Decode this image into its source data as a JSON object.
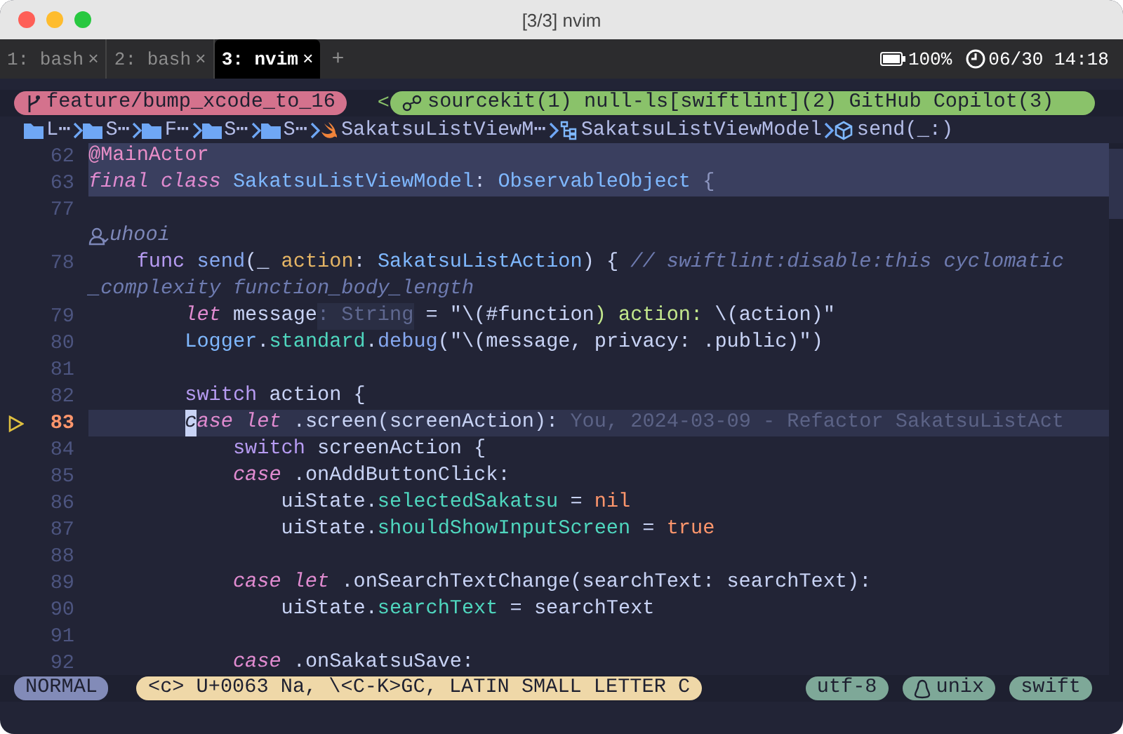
{
  "window": {
    "title": "[3/3] nvim"
  },
  "tabs": [
    {
      "label": "1: bash",
      "close": "×",
      "selected": false
    },
    {
      "label": "2: bash",
      "close": "×",
      "selected": false
    },
    {
      "label": "3: nvim",
      "close": "×",
      "selected": true
    }
  ],
  "new_tab": "+",
  "status_right": {
    "battery": "100%",
    "clock": "06/30 14:18"
  },
  "statusline_top": {
    "branch": "feature/bump_xcode_to_16",
    "lsp_separator": "<",
    "lsp": "sourcekit(1) null-ls[swiftlint](2) GitHub Copilot(3)"
  },
  "breadcrumbs": [
    {
      "kind": "folder",
      "label": "L⋯"
    },
    {
      "kind": "folder",
      "label": "S⋯"
    },
    {
      "kind": "folder",
      "label": "F⋯"
    },
    {
      "kind": "folder",
      "label": "S⋯"
    },
    {
      "kind": "folder",
      "label": "S⋯"
    },
    {
      "kind": "file",
      "label": "SakatsuListViewM⋯"
    },
    {
      "kind": "class",
      "label": "SakatsuListViewModel"
    },
    {
      "kind": "method",
      "label": "send(_:)"
    }
  ],
  "lines": [
    {
      "kind": "code",
      "number": "62",
      "sticky": true,
      "current": false,
      "sign": false,
      "tokens": [
        {
          "text": "@MainActor",
          "kind": "attribute"
        }
      ]
    },
    {
      "kind": "code",
      "number": "63",
      "sticky": true,
      "current": false,
      "sign": false,
      "tokens": [
        {
          "text": "final class",
          "kind": "keyword-italic"
        },
        {
          "text": " SakatsuListViewModel",
          "kind": "type"
        },
        {
          "text": ": ",
          "kind": "plain"
        },
        {
          "text": "ObservableObject",
          "kind": "type"
        },
        {
          "text": " {",
          "kind": "punct"
        }
      ]
    },
    {
      "kind": "code",
      "number": "77",
      "sticky": false,
      "current": false,
      "sign": false
    },
    {
      "kind": "lens",
      "sticky": false,
      "current": false,
      "sign": false,
      "tokens": [
        {
          "text": "uhooi",
          "kind": "lens"
        }
      ]
    },
    {
      "kind": "code",
      "number": "78",
      "sticky": false,
      "current": false,
      "sign": false,
      "tokens": [
        {
          "text": "    func",
          "kind": "keyword"
        },
        {
          "text": " send",
          "kind": "function"
        },
        {
          "text": "(_ ",
          "kind": "plain"
        },
        {
          "text": "action",
          "kind": "param"
        },
        {
          "text": ": ",
          "kind": "plain"
        },
        {
          "text": "SakatsuListAction",
          "kind": "type"
        },
        {
          "text": ") { ",
          "kind": "plain"
        },
        {
          "text": "// swiftlint:disable:this cyclomatic",
          "kind": "comment"
        }
      ]
    },
    {
      "kind": "wrap",
      "sticky": false,
      "current": false,
      "sign": false,
      "tokens": [
        {
          "text": "_complexity function_body_length",
          "kind": "comment"
        }
      ]
    },
    {
      "kind": "code",
      "number": "79",
      "sticky": false,
      "current": false,
      "sign": false,
      "tokens": [
        {
          "text": "        let",
          "kind": "keyword-italic"
        },
        {
          "text": " message",
          "kind": "plain"
        },
        {
          "text": ": String",
          "kind": "hint"
        },
        {
          "text": " = \"\\(#function",
          "kind": "plain"
        },
        {
          "text": ") action: ",
          "kind": "string"
        },
        {
          "text": "\\(action)\"",
          "kind": "plain"
        }
      ]
    },
    {
      "kind": "code",
      "number": "80",
      "sticky": false,
      "current": false,
      "sign": false,
      "tokens": [
        {
          "text": "        Logger",
          "kind": "type"
        },
        {
          "text": ".",
          "kind": "plain"
        },
        {
          "text": "standard",
          "kind": "property"
        },
        {
          "text": ".",
          "kind": "plain"
        },
        {
          "text": "debug",
          "kind": "function"
        },
        {
          "text": "(\"\\(message, privacy: .public)\")",
          "kind": "plain"
        }
      ]
    },
    {
      "kind": "code",
      "number": "81",
      "sticky": false,
      "current": false,
      "sign": false
    },
    {
      "kind": "code",
      "number": "82",
      "sticky": false,
      "current": false,
      "sign": false,
      "tokens": [
        {
          "text": "        switch",
          "kind": "keyword"
        },
        {
          "text": " action {",
          "kind": "plain"
        }
      ]
    },
    {
      "kind": "code",
      "number": "83",
      "sticky": false,
      "current": true,
      "sign": true,
      "tokens": [
        {
          "text": "        case let",
          "kind": "keyword-italic",
          "cursor": true
        },
        {
          "text": " .screen(screenAction):",
          "kind": "plain"
        },
        {
          "text": " You, 2024-03-09 - Refactor SakatsuListAct",
          "kind": "blame"
        }
      ]
    },
    {
      "kind": "code",
      "number": "84",
      "sticky": false,
      "current": false,
      "sign": false,
      "tokens": [
        {
          "text": "            switch",
          "kind": "keyword"
        },
        {
          "text": " screenAction {",
          "kind": "plain"
        }
      ]
    },
    {
      "kind": "code",
      "number": "85",
      "sticky": false,
      "current": false,
      "sign": false,
      "tokens": [
        {
          "text": "            case",
          "kind": "keyword-italic"
        },
        {
          "text": " .onAddButtonClick:",
          "kind": "plain"
        }
      ]
    },
    {
      "kind": "code",
      "number": "86",
      "sticky": false,
      "current": false,
      "sign": false,
      "tokens": [
        {
          "text": "                uiState.",
          "kind": "plain"
        },
        {
          "text": "selectedSakatsu",
          "kind": "property"
        },
        {
          "text": " = ",
          "kind": "plain"
        },
        {
          "text": "nil",
          "kind": "constant"
        }
      ]
    },
    {
      "kind": "code",
      "number": "87",
      "sticky": false,
      "current": false,
      "sign": false,
      "tokens": [
        {
          "text": "                uiState.",
          "kind": "plain"
        },
        {
          "text": "shouldShowInputScreen",
          "kind": "property"
        },
        {
          "text": " = ",
          "kind": "plain"
        },
        {
          "text": "true",
          "kind": "constant"
        }
      ]
    },
    {
      "kind": "code",
      "number": "88",
      "sticky": false,
      "current": false,
      "sign": false
    },
    {
      "kind": "code",
      "number": "89",
      "sticky": false,
      "current": false,
      "sign": false,
      "tokens": [
        {
          "text": "            case let",
          "kind": "keyword-italic"
        },
        {
          "text": " .onSearchTextChange(searchText: searchText):",
          "kind": "plain"
        }
      ]
    },
    {
      "kind": "code",
      "number": "90",
      "sticky": false,
      "current": false,
      "sign": false,
      "tokens": [
        {
          "text": "                uiState.",
          "kind": "plain"
        },
        {
          "text": "searchText",
          "kind": "property"
        },
        {
          "text": " = searchText",
          "kind": "plain"
        }
      ]
    },
    {
      "kind": "code",
      "number": "91",
      "sticky": false,
      "current": false,
      "sign": false
    },
    {
      "kind": "code",
      "number": "92",
      "sticky": false,
      "current": false,
      "sign": false,
      "tokens": [
        {
          "text": "            case",
          "kind": "keyword-italic"
        },
        {
          "text": " .onSakatsuSave:",
          "kind": "plain"
        }
      ]
    }
  ],
  "statusline": {
    "mode": "NORMAL",
    "char_info": "<c> U+0063 Na, \\<C-K>GC, LATIN SMALL LETTER C",
    "file_info": [
      {
        "kind": "encoding",
        "label": "utf-8"
      },
      {
        "kind": "format",
        "label": "unix"
      },
      {
        "kind": "filetype",
        "label": "swift"
      }
    ]
  }
}
